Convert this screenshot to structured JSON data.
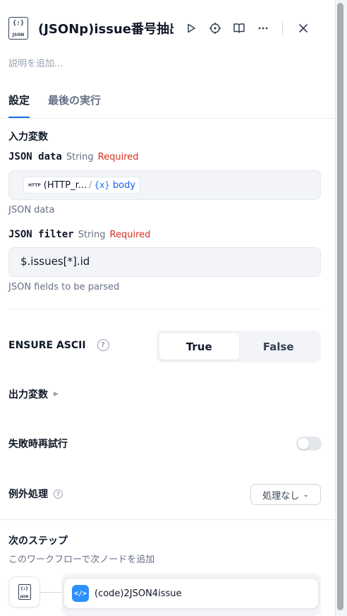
{
  "header": {
    "node_icon_text": "{:}",
    "node_icon_label": "JSON",
    "title": "(JSONp)issue番号抽出",
    "buttons": [
      "run-icon",
      "locate-icon",
      "docs-icon",
      "more-icon",
      "close-icon"
    ]
  },
  "description_placeholder": "説明を追加...",
  "tabs": [
    {
      "label": "設定",
      "active": true
    },
    {
      "label": "最後の実行",
      "active": false
    }
  ],
  "input_section": {
    "title": "入力変数",
    "variables": [
      {
        "name": "JSON data",
        "type": "String",
        "required": "Required",
        "value_pill": {
          "icon": "HTTP",
          "node": "(HTTP_r...",
          "separator": "/",
          "var_icon": "{x}",
          "var": "body"
        },
        "hint": "JSON data"
      },
      {
        "name": "JSON filter",
        "type": "String",
        "required": "Required",
        "value": "$.issues[*].id",
        "hint": "JSON fields to be parsed"
      }
    ]
  },
  "ensure_ascii": {
    "label": "ENSURE ASCII",
    "help": "?",
    "options": [
      "True",
      "False"
    ],
    "selected": "True"
  },
  "output_vars": {
    "label": "出力変数"
  },
  "retry": {
    "label": "失敗時再試行",
    "enabled": false
  },
  "error_handling": {
    "label": "例外処理",
    "help": "?",
    "selected": "処理なし"
  },
  "next_step": {
    "title": "次のステップ",
    "description": "このワークフローで次ノードを追加",
    "current_icon_text": "{:}",
    "current_icon_label": "JSON",
    "next_node_icon": "</>",
    "next_node": "(code)2JSON4issue"
  },
  "colors": {
    "accent": "#1570ef",
    "required": "#d92d20",
    "code_node": "#2e90fa"
  }
}
